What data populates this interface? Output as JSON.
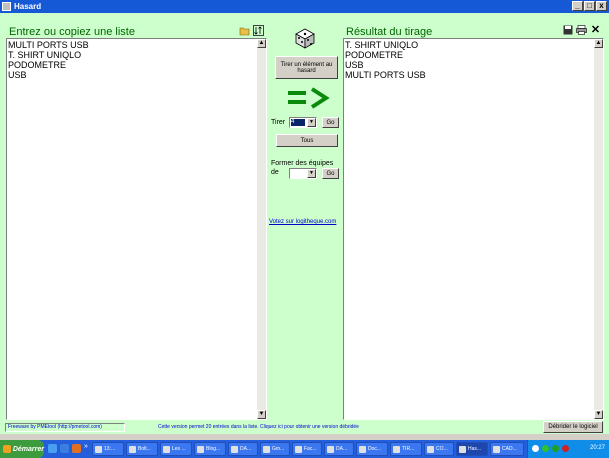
{
  "window": {
    "title": "Hasard",
    "min": "_",
    "max": "□",
    "close": "x"
  },
  "left_panel": {
    "title": "Entrez ou copiez une liste",
    "items": [
      "MULTI PORTS USB",
      "T. SHIRT UNIQLO",
      "PODOMETRE",
      "USB"
    ]
  },
  "right_panel": {
    "title": "Résultat du tirage",
    "items": [
      "T. SHIRT UNIQLO",
      "PODOMETRE",
      "USB",
      "MULTI PORTS USB"
    ]
  },
  "center": {
    "draw_one_button": "Tirer un élément au hasard",
    "draw_label": "Tirer",
    "draw_count": "4",
    "go1": "Go",
    "all_button": "Tous",
    "teams_label_1": "Former des équipes",
    "teams_label_2": "de",
    "teams_value": "",
    "go2": "Go",
    "vote_link": "Votez sur logitheque.com"
  },
  "status": {
    "freeware": "Freeware by PMEtool (http://pmetool.com)",
    "message": "Cette version permet 20 entrées dans la liste. Cliquez ici pour obtenir une version débridée",
    "unlock_button": "Débrider le logiciel"
  },
  "taskbar": {
    "start": "Démarrer",
    "buttons": [
      "13:...",
      "Bolt...",
      "Les ...",
      "Blog...",
      "DA...",
      "Gm...",
      "Fac...",
      "DA...",
      "Doc...",
      "TIR...",
      "CO...",
      "Has...",
      "CAD..."
    ],
    "clock": "20:27"
  },
  "colors": {
    "panel_bg": "#ccffcc",
    "title_green": "#006600",
    "arrow_green": "#0a8a0a",
    "link_blue": "#0000cc"
  }
}
